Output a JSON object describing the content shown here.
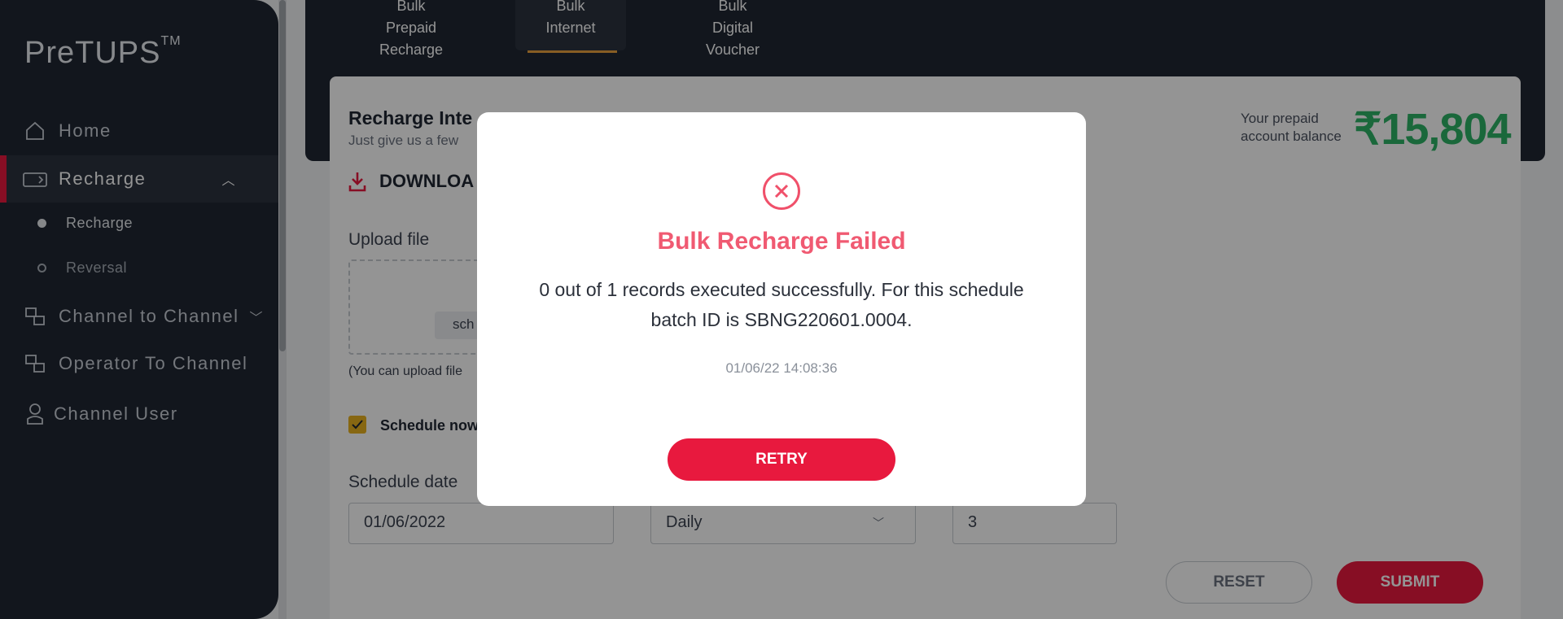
{
  "sidebar": {
    "brand": "PreTUPS",
    "brand_mark": "TM",
    "items": {
      "home": "Home",
      "recharge": "Recharge",
      "recharge_sub": "Recharge",
      "reversal_sub": "Reversal",
      "c2c": "Channel to Channel",
      "o2c": "Operator To Channel",
      "channel_user": "Channel User"
    }
  },
  "tabs": [
    {
      "line1": "Bulk",
      "line2": "Prepaid",
      "line3": "Recharge"
    },
    {
      "line1": "Bulk",
      "line2": "Internet",
      "line3": ""
    },
    {
      "line1": "Bulk",
      "line2": "Digital",
      "line3": "Voucher"
    }
  ],
  "card": {
    "title": "Recharge Inte",
    "subtitle": "Just give us a few",
    "balance_label_1": "Your prepaid",
    "balance_label_2": "account balance",
    "balance_value": "₹15,804",
    "download": "DOWNLOA",
    "upload_label": "Upload file",
    "upload_button": "sch",
    "upload_note": "(You can upload file",
    "schedule_now": "Schedule now",
    "schedule_date_label": "Schedule date",
    "schedule_date_value": "01/06/2022",
    "frequency_value": "Daily",
    "third_label_fragment": ")",
    "third_value": "3",
    "reset": "RESET",
    "submit": "SUBMIT"
  },
  "modal": {
    "title": "Bulk Recharge Failed",
    "message": "0 out of 1 records executed successfully. For this schedule batch ID is SBNG220601.0004.",
    "timestamp": "01/06/22 14:08:36",
    "retry": "RETRY"
  },
  "colors": {
    "accent": "#e8193e",
    "sidebar": "#1f2733",
    "balance": "#2eb366",
    "error_title": "#f05a72",
    "checkbox": "#e8b21f"
  }
}
